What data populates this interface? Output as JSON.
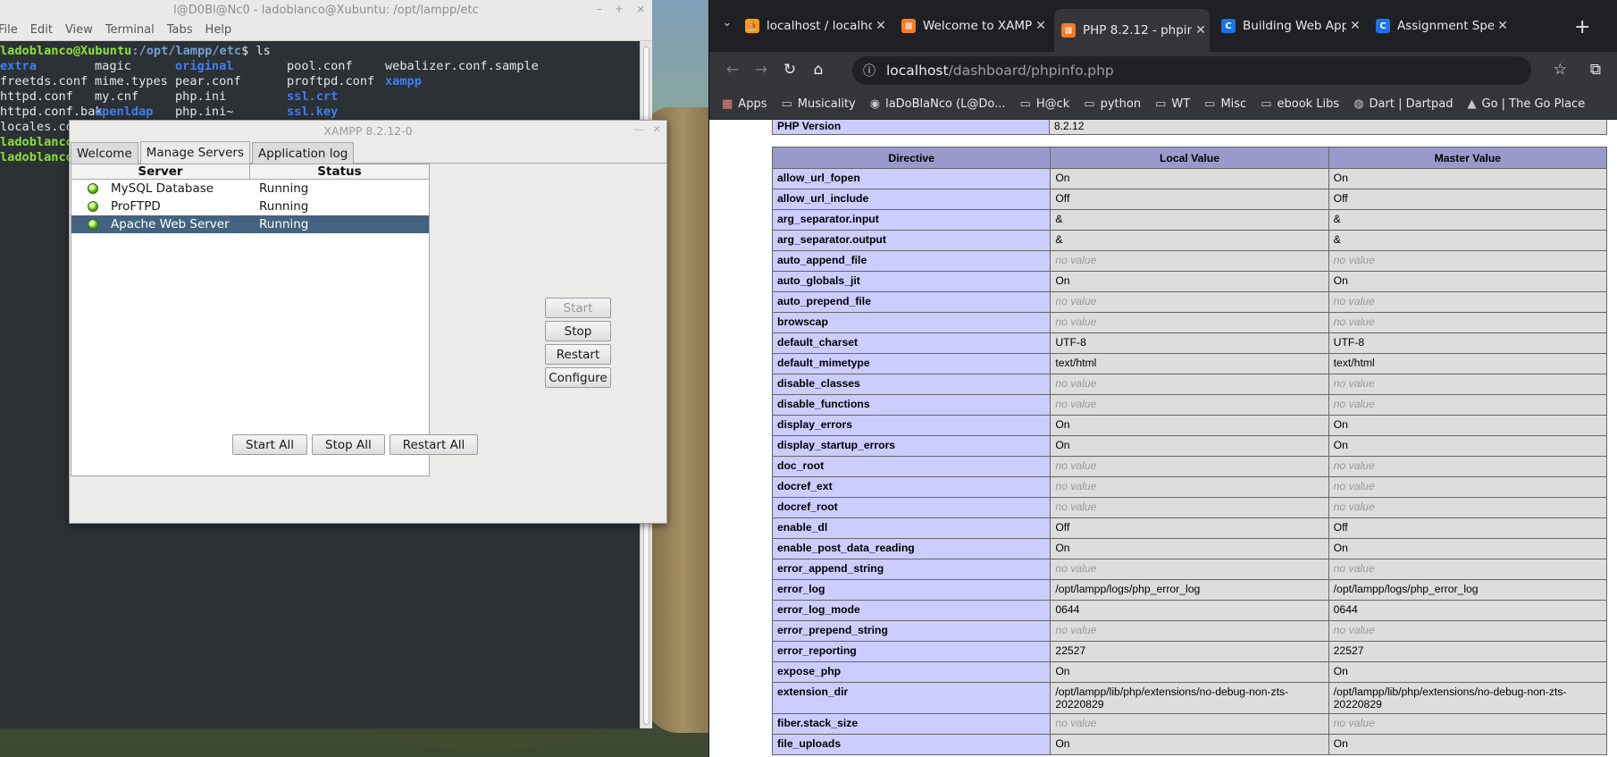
{
  "terminal": {
    "window_title": "l@D0Bl@Nc0 - ladoblanco@Xubuntu: /opt/lampp/etc",
    "menu": [
      "File",
      "Edit",
      "View",
      "Terminal",
      "Tabs",
      "Help"
    ],
    "prompt_user": "ladoblanco@Xubuntu",
    "prompt_path": ":/opt/lampp/etc",
    "prompt_cmd": "$ ls",
    "ls_rows": [
      [
        {
          "t": "extra",
          "dir": true
        },
        {
          "t": "magic"
        },
        {
          "t": "original",
          "dir": true
        },
        {
          "t": "pool.conf"
        },
        {
          "t": "webalizer.conf.sample"
        }
      ],
      [
        {
          "t": "freetds.conf"
        },
        {
          "t": "mime.types"
        },
        {
          "t": "pear.conf"
        },
        {
          "t": "proftpd.conf"
        },
        {
          "t": "xampp",
          "dir": true
        }
      ],
      [
        {
          "t": "httpd.conf"
        },
        {
          "t": "my.cnf"
        },
        {
          "t": "php.ini"
        },
        {
          "t": "ssl.crt",
          "dir": true
        }
      ],
      [
        {
          "t": "httpd.conf.bak"
        },
        {
          "t": "openldap",
          "dir": true
        },
        {
          "t": "php.ini~"
        },
        {
          "t": "ssl.key",
          "dir": true
        }
      ],
      [
        {
          "t": "locales.conf"
        }
      ]
    ],
    "trailing_prompts": [
      "ladoblanco@",
      "ladoblanco@"
    ]
  },
  "xampp": {
    "window_title": "XAMPP 8.2.12-0",
    "tabs": [
      "Welcome",
      "Manage Servers",
      "Application log"
    ],
    "active_tab": "Manage Servers",
    "columns": {
      "server": "Server",
      "status": "Status"
    },
    "servers": [
      {
        "name": "MySQL Database",
        "status": "Running",
        "selected": false
      },
      {
        "name": "ProFTPD",
        "status": "Running",
        "selected": false
      },
      {
        "name": "Apache Web Server",
        "status": "Running",
        "selected": true
      }
    ],
    "side_buttons": {
      "start": "Start",
      "stop": "Stop",
      "restart": "Restart",
      "configure": "Configure"
    },
    "bottom_buttons": {
      "start_all": "Start All",
      "stop_all": "Stop All",
      "restart_all": "Restart All"
    }
  },
  "browser": {
    "tabs": [
      {
        "title": "localhost / localho",
        "icon": "phpmyadmin-icon",
        "color": "#f89c0e",
        "active": false
      },
      {
        "title": "Welcome to XAMPP",
        "icon": "xampp-icon",
        "color": "#fb7a24",
        "active": false
      },
      {
        "title": "PHP 8.2.12 - phpin",
        "icon": "xampp-icon",
        "color": "#fb7a24",
        "active": true
      },
      {
        "title": "Building Web App",
        "icon": "c-icon",
        "color": "#1a73e8",
        "active": false
      },
      {
        "title": "Assignment Speci",
        "icon": "c-icon",
        "color": "#1a73e8",
        "active": false
      }
    ],
    "url_host": "localhost",
    "url_path": "/dashboard/phpinfo.php",
    "bookmarks": [
      "Apps",
      "Musicality",
      "laDoBlaNco (L@Do...",
      "H@ck",
      "python",
      "WT",
      "Misc",
      "ebook Libs",
      "Dart | Dartpad",
      "Go | The Go Place"
    ],
    "php_version_label": "PHP Version",
    "php_version_value": "8.2.12",
    "table_headers": [
      "Directive",
      "Local Value",
      "Master Value"
    ],
    "directives": [
      {
        "name": "allow_url_fopen",
        "local": "On",
        "master": "On"
      },
      {
        "name": "allow_url_include",
        "local": "Off",
        "master": "Off"
      },
      {
        "name": "arg_separator.input",
        "local": "&",
        "master": "&"
      },
      {
        "name": "arg_separator.output",
        "local": "&",
        "master": "&"
      },
      {
        "name": "auto_append_file",
        "local": "no value",
        "master": "no value"
      },
      {
        "name": "auto_globals_jit",
        "local": "On",
        "master": "On"
      },
      {
        "name": "auto_prepend_file",
        "local": "no value",
        "master": "no value"
      },
      {
        "name": "browscap",
        "local": "no value",
        "master": "no value"
      },
      {
        "name": "default_charset",
        "local": "UTF-8",
        "master": "UTF-8"
      },
      {
        "name": "default_mimetype",
        "local": "text/html",
        "master": "text/html"
      },
      {
        "name": "disable_classes",
        "local": "no value",
        "master": "no value"
      },
      {
        "name": "disable_functions",
        "local": "no value",
        "master": "no value"
      },
      {
        "name": "display_errors",
        "local": "On",
        "master": "On"
      },
      {
        "name": "display_startup_errors",
        "local": "On",
        "master": "On"
      },
      {
        "name": "doc_root",
        "local": "no value",
        "master": "no value"
      },
      {
        "name": "docref_ext",
        "local": "no value",
        "master": "no value"
      },
      {
        "name": "docref_root",
        "local": "no value",
        "master": "no value"
      },
      {
        "name": "enable_dl",
        "local": "Off",
        "master": "Off"
      },
      {
        "name": "enable_post_data_reading",
        "local": "On",
        "master": "On"
      },
      {
        "name": "error_append_string",
        "local": "no value",
        "master": "no value"
      },
      {
        "name": "error_log",
        "local": "/opt/lampp/logs/php_error_log",
        "master": "/opt/lampp/logs/php_error_log"
      },
      {
        "name": "error_log_mode",
        "local": "0644",
        "master": "0644"
      },
      {
        "name": "error_prepend_string",
        "local": "no value",
        "master": "no value"
      },
      {
        "name": "error_reporting",
        "local": "22527",
        "master": "22527"
      },
      {
        "name": "expose_php",
        "local": "On",
        "master": "On"
      },
      {
        "name": "extension_dir",
        "local": "/opt/lampp/lib/php/extensions/no-debug-non-zts-20220829",
        "master": "/opt/lampp/lib/php/extensions/no-debug-non-zts-20220829"
      },
      {
        "name": "fiber.stack_size",
        "local": "no value",
        "master": "no value"
      },
      {
        "name": "file_uploads",
        "local": "On",
        "master": "On"
      }
    ]
  }
}
